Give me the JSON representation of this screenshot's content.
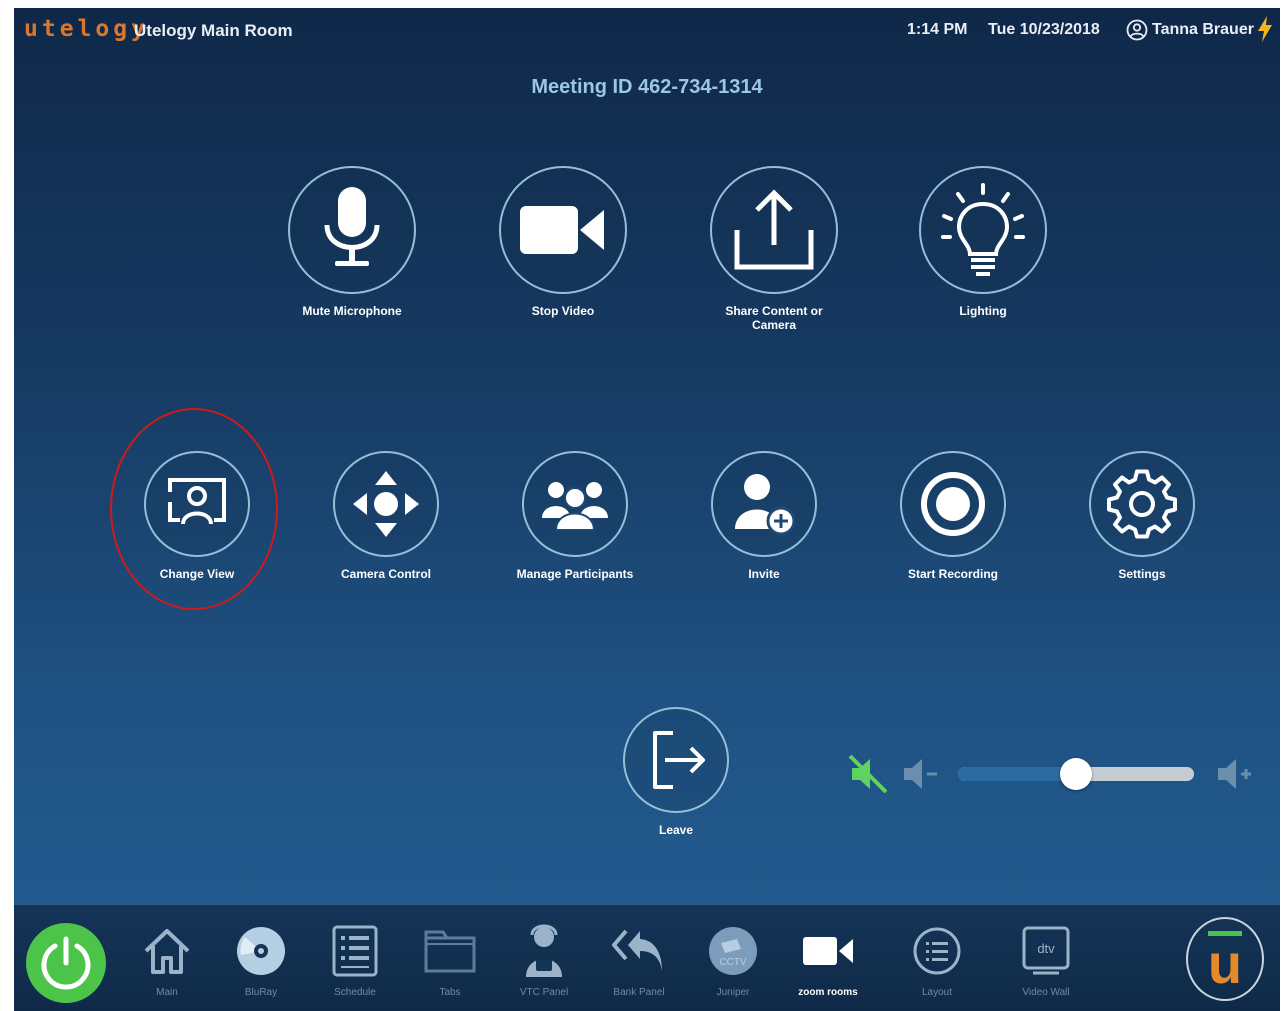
{
  "header": {
    "brand": "utelogy",
    "room_name": "Utelogy Main Room",
    "time": "1:14 PM",
    "date": "Tue 10/23/2018",
    "user_name": "Tanna Brauer"
  },
  "meeting": {
    "id_text": "Meeting ID 462-734-1314"
  },
  "controls_row1": [
    {
      "label": "Mute Microphone",
      "icon": "microphone-icon"
    },
    {
      "label": "Stop Video",
      "icon": "video-camera-icon"
    },
    {
      "label": "Share Content or Camera",
      "icon": "share-upload-icon"
    },
    {
      "label": "Lighting",
      "icon": "lightbulb-icon"
    }
  ],
  "controls_row2": [
    {
      "label": "Change View",
      "icon": "change-view-icon",
      "highlighted": true
    },
    {
      "label": "Camera Control",
      "icon": "camera-control-dpad-icon"
    },
    {
      "label": "Manage Participants",
      "icon": "participants-icon"
    },
    {
      "label": "Invite",
      "icon": "invite-user-icon"
    },
    {
      "label": "Start Recording",
      "icon": "record-icon"
    },
    {
      "label": "Settings",
      "icon": "gear-icon"
    }
  ],
  "leave": {
    "label": "Leave",
    "icon": "exit-icon"
  },
  "volume": {
    "level_percent": 50,
    "muted": false
  },
  "colors": {
    "accent_green": "#4cc44a",
    "brand_orange": "#d8782f",
    "highlight_red": "#d01a1a",
    "ring": "#93bfd9"
  },
  "nav": {
    "items": [
      {
        "label": "Main",
        "icon": "home-icon"
      },
      {
        "label": "BluRay",
        "icon": "disc-icon"
      },
      {
        "label": "Schedule",
        "icon": "schedule-list-icon"
      },
      {
        "label": "Tabs",
        "icon": "folder-tabs-icon"
      },
      {
        "label": "VTC Panel",
        "icon": "vtc-agent-icon"
      },
      {
        "label": "Bank Panel",
        "icon": "reply-all-icon"
      },
      {
        "label": "Juniper",
        "icon": "cctv-icon"
      },
      {
        "label": "zoom rooms",
        "icon": "video-camera-icon",
        "active": true
      },
      {
        "label": "Layout",
        "icon": "layout-list-icon"
      },
      {
        "label": "Video Wall",
        "icon": "dtv-icon"
      }
    ],
    "logo_letter": "u"
  }
}
